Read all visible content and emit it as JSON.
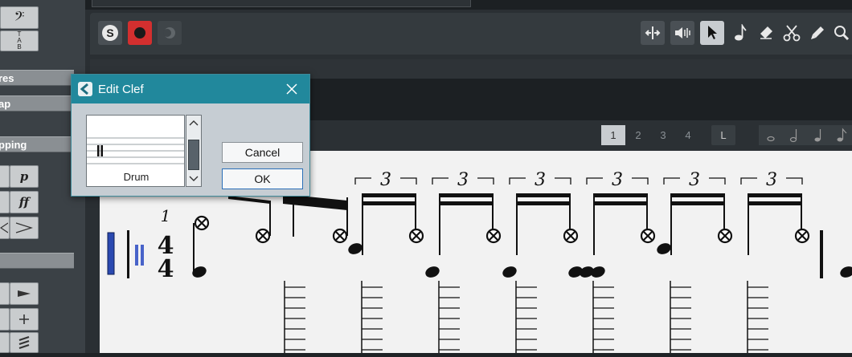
{
  "left_panel": {
    "clef_buttons": [
      {
        "icon": "bass-clef-icon"
      },
      {
        "icon": "tab-clef-icon"
      }
    ],
    "sections": [
      {
        "label": "res"
      },
      {
        "label": "ap"
      },
      {
        "label": "pping"
      }
    ],
    "dynamics": [
      {
        "label": "p"
      },
      {
        "label": "ff"
      }
    ],
    "articulations": [
      {
        "icon": "accent-icon"
      },
      {
        "icon": "plus-icon"
      },
      {
        "icon": "tremolo-icon"
      }
    ]
  },
  "toolbar": {
    "left_buttons": [
      {
        "label": "S"
      },
      {
        "icon": "record-icon"
      },
      {
        "icon": "monitor-icon"
      }
    ],
    "tools": [
      {
        "icon": "split-icon"
      },
      {
        "icon": "speaker-icon"
      },
      {
        "icon": "arrow-pointer-icon"
      },
      {
        "icon": "note-icon"
      },
      {
        "icon": "eraser-icon"
      },
      {
        "icon": "scissors-icon"
      },
      {
        "icon": "marker-icon"
      },
      {
        "icon": "zoom-icon"
      }
    ]
  },
  "page_buttons": {
    "pages": [
      "1",
      "2",
      "3",
      "4"
    ],
    "selected": "1",
    "layout": "L"
  },
  "score": {
    "bar_number": "1",
    "time_signature": {
      "top": "4",
      "bottom": "4"
    },
    "tuplet_label": "3"
  },
  "dialog": {
    "title": "Edit Clef",
    "preview_label": "Drum",
    "cancel_label": "Cancel",
    "ok_label": "OK",
    "scroll_position": 0.45
  },
  "colors": {
    "dialog_title": "#21889c",
    "staff_lines": "#3b5bb8",
    "record": "#d32f2f"
  }
}
